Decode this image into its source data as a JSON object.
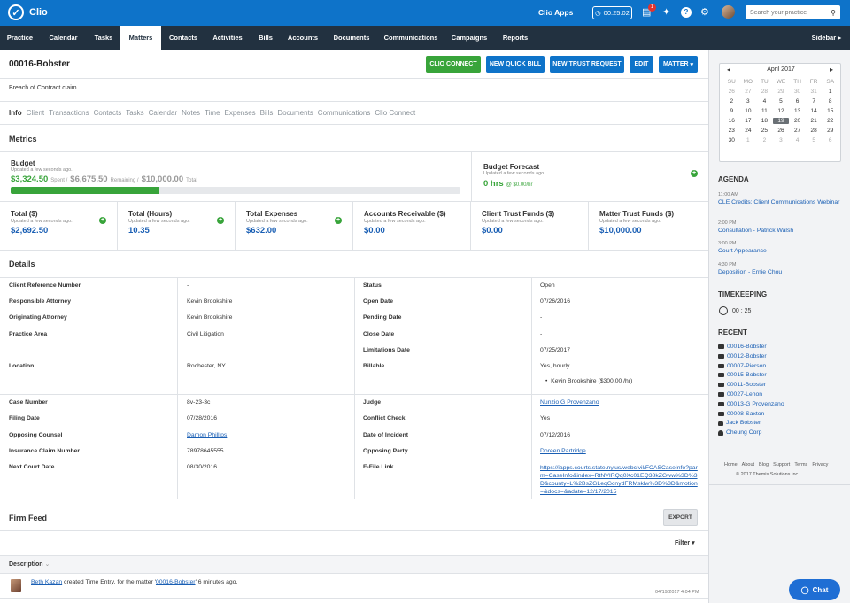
{
  "topbar": {
    "brand": "Clio",
    "apps": "Clio Apps",
    "timer": "00:25:02",
    "notifications_count": "1",
    "search_placeholder": "Search your practice"
  },
  "nav": {
    "items": [
      "Practice",
      "Calendar",
      "Tasks",
      "Matters",
      "Contacts",
      "Activities",
      "Bills",
      "Accounts",
      "Documents",
      "Communications",
      "Campaigns",
      "Reports"
    ],
    "active": "Matters",
    "sidebar": "Sidebar"
  },
  "matter": {
    "title": "00016-Bobster",
    "description": "Breach of Contract claim",
    "buttons": {
      "clio_connect": "CLIO CONNECT",
      "quick_bill": "NEW QUICK BILL",
      "trust_request": "NEW TRUST REQUEST",
      "edit": "EDIT",
      "matter": "MATTER"
    }
  },
  "tabs": [
    "Info",
    "Client",
    "Transactions",
    "Contacts",
    "Tasks",
    "Calendar",
    "Notes",
    "Time",
    "Expenses",
    "Bills",
    "Documents",
    "Communications",
    "Clio Connect"
  ],
  "metrics": {
    "heading": "Metrics",
    "budget": {
      "title": "Budget",
      "updated": "Updated a few seconds ago.",
      "spent": "$3,324.50",
      "spent_label": "Spent /",
      "remaining": "$6,675.50",
      "remaining_label": "Remaining /",
      "total": "$10,000.00",
      "total_label": "Total",
      "progress": 0.33
    },
    "forecast": {
      "title": "Budget Forecast",
      "updated": "Updated a few seconds ago.",
      "hrs": "0 hrs",
      "rate": "@ $0.00/hr"
    },
    "cards": [
      {
        "title": "Total ($)",
        "updated": "Updated a few seconds ago.",
        "value": "$2,692.50",
        "plus": true
      },
      {
        "title": "Total (Hours)",
        "updated": "Updated a few seconds ago.",
        "value": "10.35",
        "plus": true
      },
      {
        "title": "Total Expenses",
        "updated": "Updated a few seconds ago.",
        "value": "$632.00",
        "plus": true
      },
      {
        "title": "Accounts Receivable ($)",
        "updated": "Updated a few seconds ago.",
        "value": "$0.00",
        "plus": false
      },
      {
        "title": "Client Trust Funds ($)",
        "updated": "Updated a few seconds ago.",
        "value": "$0.00",
        "plus": false
      },
      {
        "title": "Matter Trust Funds ($)",
        "updated": "Updated a few seconds ago.",
        "value": "$10,000.00",
        "plus": false
      }
    ]
  },
  "details": {
    "heading": "Details",
    "left1": [
      [
        "Client Reference Number",
        "-"
      ],
      [
        "Responsible Attorney",
        "Kevin Brookshire"
      ],
      [
        "Originating Attorney",
        "Kevin Brookshire"
      ],
      [
        "Practice Area",
        "Civil Litigation"
      ],
      [
        "Location",
        "Rochester, NY"
      ]
    ],
    "right1": [
      [
        "Status",
        "Open"
      ],
      [
        "Open Date",
        "07/26/2016"
      ],
      [
        "Pending Date",
        "-"
      ],
      [
        "Close Date",
        "-"
      ],
      [
        "Limitations Date",
        "07/25/2017"
      ],
      [
        "Billable",
        "Yes, hourly"
      ]
    ],
    "billable_rate": "Kevin Brookshire ($300.00 /hr)",
    "left2": [
      [
        "Case Number",
        "8v-23-3c"
      ],
      [
        "Filing Date",
        "07/28/2016"
      ],
      [
        "Opposing Counsel",
        "Damon Phillips"
      ],
      [
        "Insurance Claim Number",
        "78978645555"
      ],
      [
        "Next Court Date",
        "08/30/2016"
      ]
    ],
    "right2": [
      [
        "Judge",
        "Nunzio G Provenzano"
      ],
      [
        "Conflict Check",
        "Yes"
      ],
      [
        "Date of Incident",
        "07/12/2016"
      ],
      [
        "Opposing Party",
        "Doreen Partridge"
      ],
      [
        "E-File Link",
        "https://iapps.courts.state.ny.us/webcivil/FCASCaseInfo?parm=CaseInfo&index=RtNVIRQq0Xc01EQ38kZGww%3D%3D&county=L%2BsZGLeqGcnydFRMsklw%3D%3D&motion=&docs=&adate=12/17/2015"
      ]
    ]
  },
  "feed": {
    "heading": "Firm Feed",
    "export": "EXPORT",
    "filter": "Filter",
    "col": "Description",
    "entry_user": "Beth Kazan",
    "entry_text": " created Time Entry, for the matter '",
    "entry_matter": "00016-Bobster",
    "entry_suffix": "' 6 minutes ago.",
    "entry_time": "04/19/2017 4:04 PM"
  },
  "calendar": {
    "month": "April 2017",
    "dow": [
      "SU",
      "MO",
      "TU",
      "WE",
      "TH",
      "FR",
      "SA"
    ],
    "days": [
      [
        "26",
        "27",
        "28",
        "29",
        "30",
        "31",
        "1"
      ],
      [
        "2",
        "3",
        "4",
        "5",
        "6",
        "7",
        "8"
      ],
      [
        "9",
        "10",
        "11",
        "12",
        "13",
        "14",
        "15"
      ],
      [
        "16",
        "17",
        "18",
        "19",
        "20",
        "21",
        "22"
      ],
      [
        "23",
        "24",
        "25",
        "26",
        "27",
        "28",
        "29"
      ],
      [
        "30",
        "1",
        "2",
        "3",
        "4",
        "5",
        "6"
      ]
    ],
    "today": "19"
  },
  "agenda": {
    "heading": "AGENDA",
    "items": [
      {
        "time": "11:00 AM",
        "title": "CLE Credits: Client Communications Webinar"
      },
      {
        "time": "2:00 PM",
        "title": "Consultation - Patrick Walsh"
      },
      {
        "time": "3:00 PM",
        "title": "Court Appearance"
      },
      {
        "time": "4:30 PM",
        "title": "Deposition - Ernie Chou"
      }
    ]
  },
  "timekeeping": {
    "heading": "TIMEKEEPING",
    "value": "00 : 25"
  },
  "recent": {
    "heading": "RECENT",
    "items": [
      {
        "label": "00016-Bobster",
        "kind": "matter"
      },
      {
        "label": "00012-Bobster",
        "kind": "matter"
      },
      {
        "label": "00007-Pierson",
        "kind": "matter"
      },
      {
        "label": "00015-Bobster",
        "kind": "matter"
      },
      {
        "label": "00011-Bobster",
        "kind": "matter"
      },
      {
        "label": "00027-Lenon",
        "kind": "matter"
      },
      {
        "label": "00013-G Provenzano",
        "kind": "matter"
      },
      {
        "label": "00008-Saxton",
        "kind": "matter"
      },
      {
        "label": "Jack Bobster",
        "kind": "person"
      },
      {
        "label": "Cheung Corp",
        "kind": "person"
      }
    ]
  },
  "footer": {
    "links": [
      "Home",
      "About",
      "Blog",
      "Support",
      "Terms",
      "Privacy"
    ],
    "copyright": "© 2017 Themis Solutions Inc."
  },
  "chat": "Chat",
  "colors": {
    "brand_blue": "#0e73c9",
    "nav_dark": "#223140",
    "green": "#38a43a",
    "link": "#1a5fb4"
  }
}
